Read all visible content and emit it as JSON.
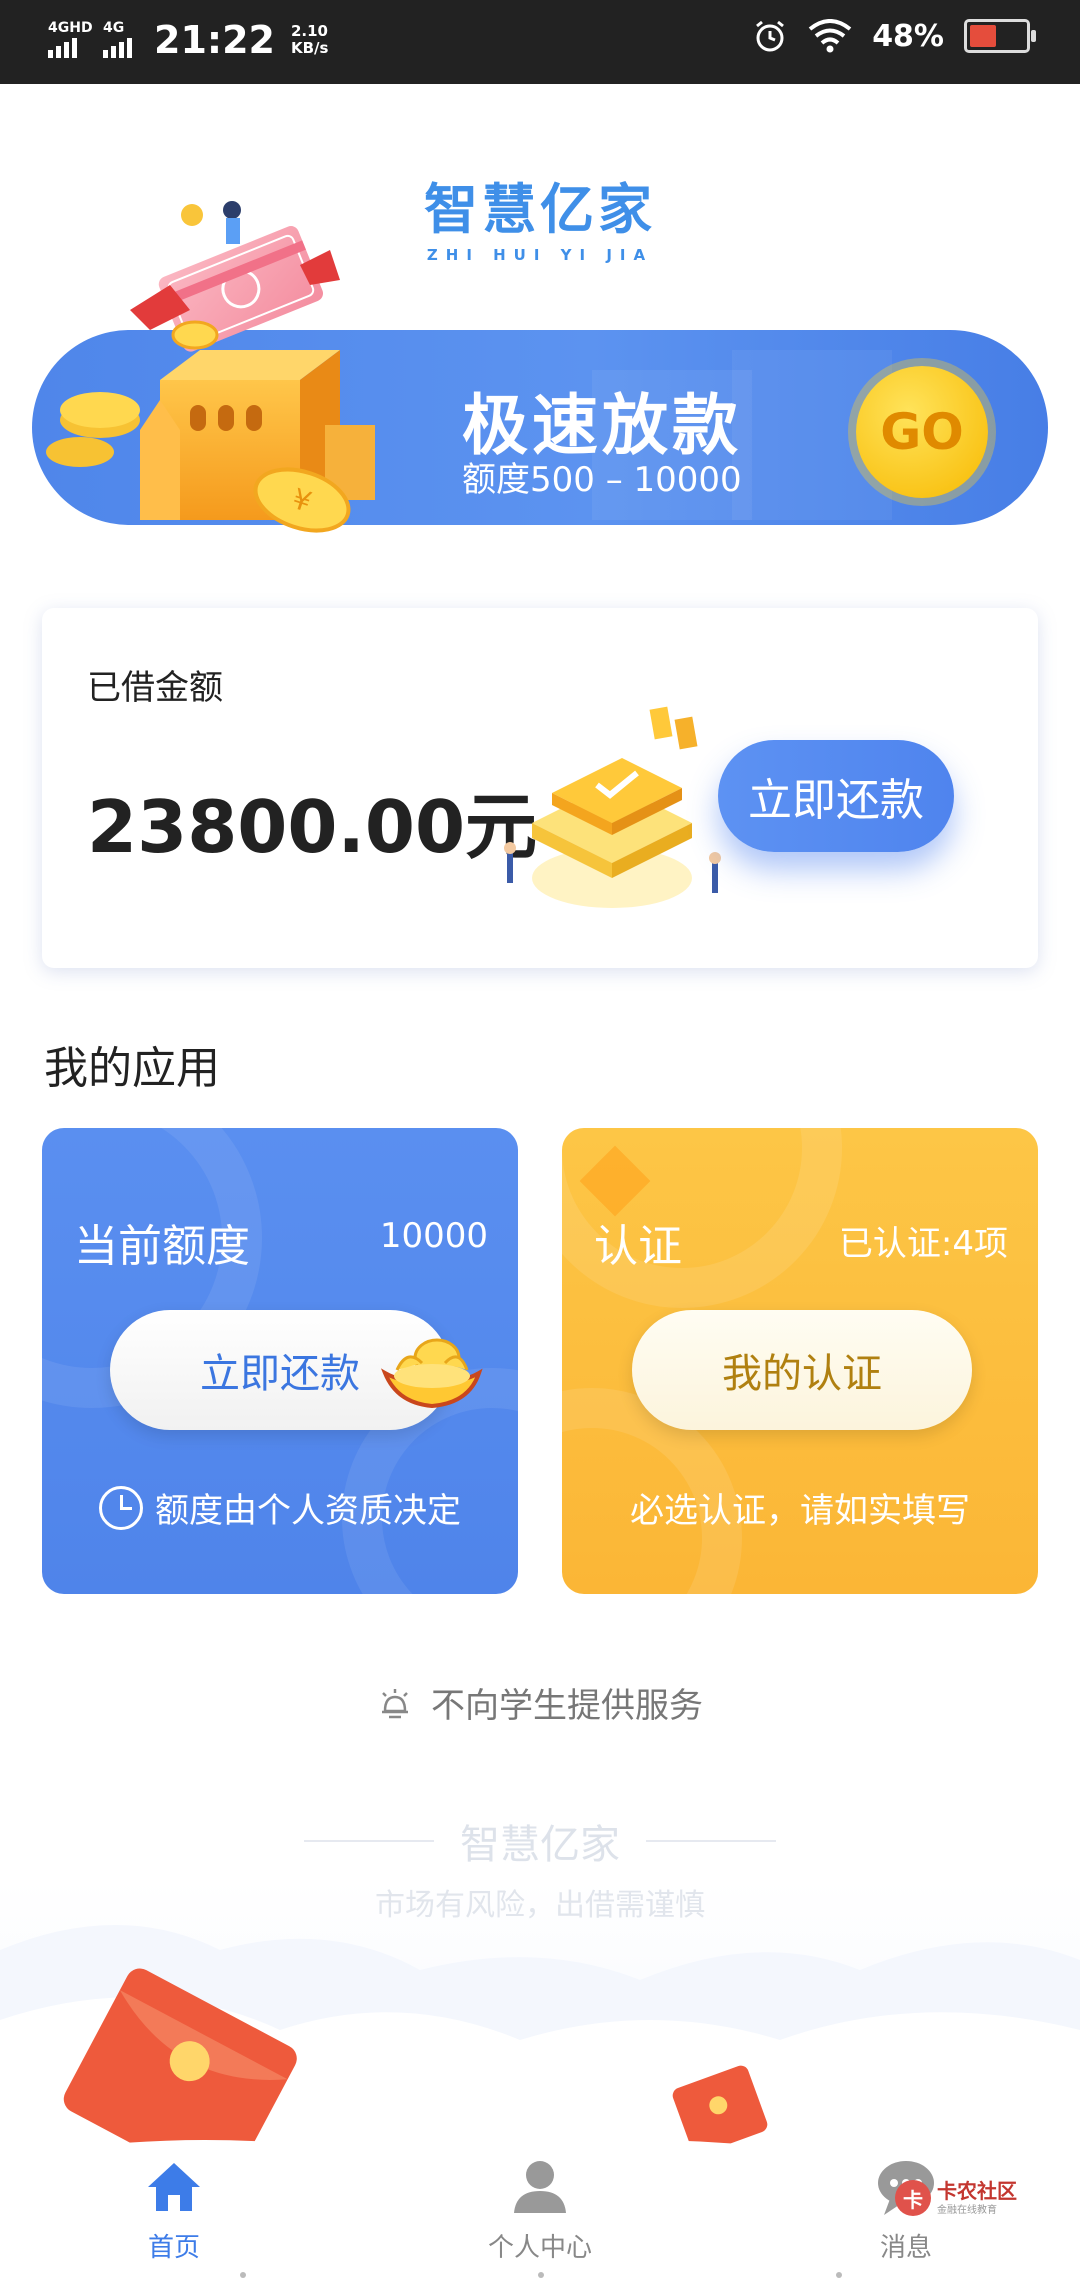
{
  "status_bar": {
    "network1": "4GHD",
    "network2": "4G",
    "time": "21:22",
    "speed_value": "2.10",
    "speed_unit": "KB/s",
    "battery": "48%",
    "battery_level": 0.48,
    "battery_color": "#e54d3c"
  },
  "logo": {
    "title": "智慧亿家",
    "pinyin": "ZHI HUI YI JIA"
  },
  "banner": {
    "title": "极速放款",
    "subtitle": "额度500 – 10000",
    "go_label": "GO"
  },
  "loan_card": {
    "label": "已借金额",
    "amount": "23800.00元",
    "repay_button": "立即还款"
  },
  "section": {
    "title": "我的应用"
  },
  "quota_card": {
    "title": "当前额度",
    "value": "10000",
    "button": "立即还款",
    "footer": "额度由个人资质决定",
    "color": "#4f84ea"
  },
  "auth_card": {
    "title": "认证",
    "status": "已认证:4项",
    "button": "我的认证",
    "footer": "必选认证，请如实填写",
    "color": "#fbb636"
  },
  "notice": {
    "text": "不向学生提供服务"
  },
  "brand_footer": {
    "name": "智慧亿家",
    "risk": "市场有风险，出借需谨慎"
  },
  "bottom_nav": {
    "items": [
      {
        "label": "首页",
        "icon": "home-icon",
        "active": true
      },
      {
        "label": "个人中心",
        "icon": "user-icon",
        "active": false
      },
      {
        "label": "消息",
        "icon": "message-icon",
        "active": false
      }
    ],
    "active_color": "#3d7ce8"
  },
  "watermark": {
    "text": "卡农社区",
    "sub": "金融在线教育"
  }
}
